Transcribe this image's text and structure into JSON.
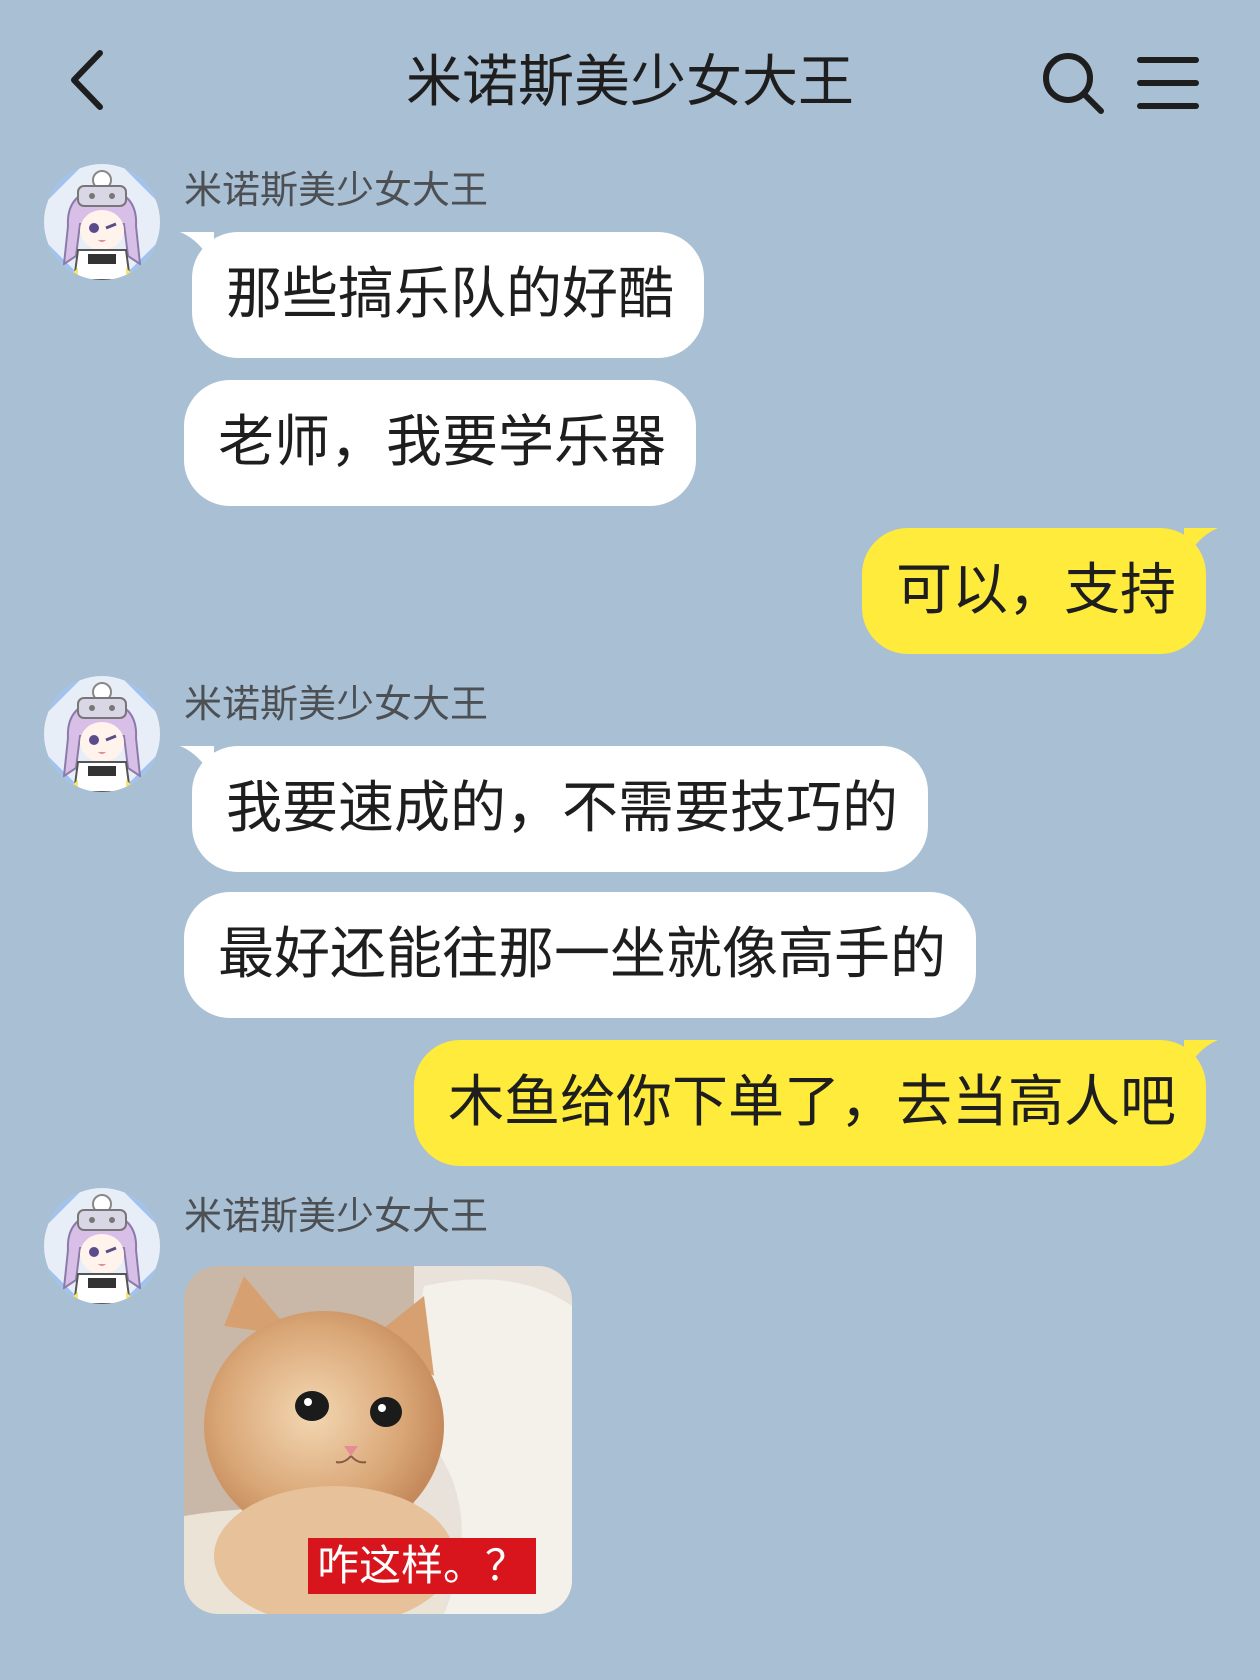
{
  "header": {
    "title": "米诺斯美少女大王",
    "back_icon": "chevron-left-icon",
    "search_icon": "search-icon",
    "menu_icon": "hamburger-menu-icon"
  },
  "colors": {
    "background": "#a9bfd3",
    "incoming_bubble": "#ffffff",
    "outgoing_bubble": "#ffeb3b",
    "caption_red": "#d8141c"
  },
  "messages": [
    {
      "sender": "米诺斯美少女大王",
      "direction": "in",
      "text": "那些搞乐队的好酷"
    },
    {
      "direction": "in",
      "text": "老师，我要学乐器"
    },
    {
      "direction": "out",
      "text": "可以，支持"
    },
    {
      "sender": "米诺斯美少女大王",
      "direction": "in",
      "text": "我要速成的，不需要技巧的"
    },
    {
      "direction": "in",
      "text": "最好还能往那一坐就像高手的"
    },
    {
      "direction": "out",
      "text": "木鱼给你下单了，去当高人吧"
    },
    {
      "sender": "米诺斯美少女大王",
      "direction": "in",
      "type": "image",
      "caption": "咋这样。？"
    }
  ]
}
